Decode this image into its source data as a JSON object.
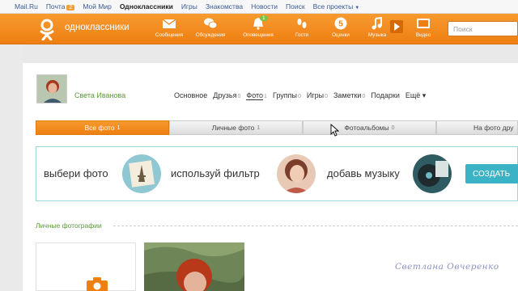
{
  "portal": {
    "links": [
      "Mail.Ru",
      "Почта",
      "Мой Мир",
      "Одноклассники",
      "Игры",
      "Знакомства",
      "Новости",
      "Поиск",
      "Все проекты"
    ],
    "mail_badge": "2"
  },
  "header": {
    "brand": "одноклассники",
    "nav": [
      "Сообщения",
      "Обсуждения",
      "Оповещения",
      "Гости",
      "Оценки",
      "Музыка",
      "Видео"
    ],
    "notif_badge": "1",
    "search_placeholder": "Поиск"
  },
  "profile": {
    "name": "Света Иванова",
    "nav": [
      {
        "label": "Основное",
        "count": ""
      },
      {
        "label": "Друзья",
        "count": "0"
      },
      {
        "label": "Фото",
        "count": "1"
      },
      {
        "label": "Группы",
        "count": "0"
      },
      {
        "label": "Игры",
        "count": "0"
      },
      {
        "label": "Заметки",
        "count": "0"
      },
      {
        "label": "Подарки",
        "count": ""
      },
      {
        "label": "Ещё ▾",
        "count": ""
      }
    ]
  },
  "tabs": [
    {
      "label": "Все фото",
      "count": "1"
    },
    {
      "label": "Личные фото",
      "count": "1"
    },
    {
      "label": "Фотоальбомы",
      "count": "0"
    },
    {
      "label": "На фото дру",
      "count": ""
    }
  ],
  "promo": {
    "step1": "выбери фото",
    "step2": "используй фильтр",
    "step3": "добавь музыку",
    "button": "СОЗДАТЬ"
  },
  "section_title": "Личные фотографии",
  "watermark": "Светлана  Овчеренко",
  "colors": {
    "orange": "#ee7f12",
    "green": "#5a9c37",
    "teal": "#3cb2c7"
  }
}
